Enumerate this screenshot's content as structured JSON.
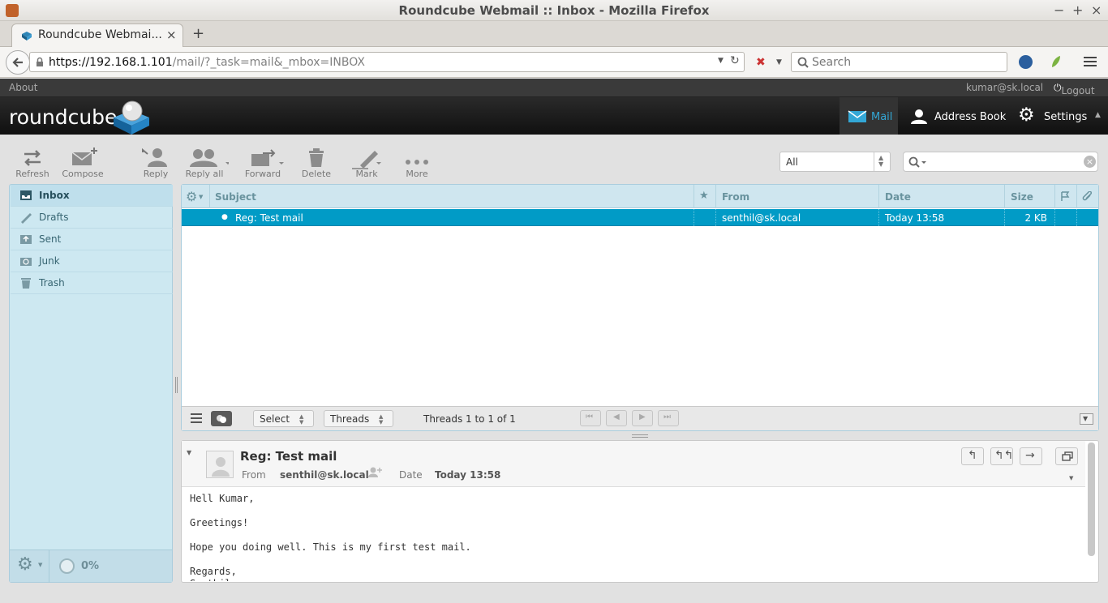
{
  "window": {
    "title": "Roundcube Webmail :: Inbox - Mozilla Firefox"
  },
  "browser": {
    "tab_title": "Roundcube Webmai...",
    "url_host": "https://192.168.1.101",
    "url_path": "/mail/?_task=mail&_mbox=INBOX",
    "search_placeholder": "Search"
  },
  "topbar": {
    "about": "About",
    "user": "kumar@sk.local",
    "logout": "Logout"
  },
  "app": {
    "logo": "roundcube",
    "nav": [
      {
        "label": "Mail",
        "icon": "envelope-icon",
        "active": true
      },
      {
        "label": "Address Book",
        "icon": "person-icon"
      },
      {
        "label": "Settings",
        "icon": "gear-icon"
      }
    ]
  },
  "toolbar": {
    "refresh": "Refresh",
    "compose": "Compose",
    "reply": "Reply",
    "reply_all": "Reply all",
    "forward": "Forward",
    "delete": "Delete",
    "mark": "Mark",
    "more": "More",
    "filter": "All"
  },
  "folders": [
    {
      "name": "Inbox",
      "icon": "inbox-icon",
      "active": true
    },
    {
      "name": "Drafts",
      "icon": "pencil-icon"
    },
    {
      "name": "Sent",
      "icon": "sent-icon"
    },
    {
      "name": "Junk",
      "icon": "junk-icon"
    },
    {
      "name": "Trash",
      "icon": "trash-icon"
    }
  ],
  "quota": "0%",
  "list": {
    "columns": {
      "subject": "Subject",
      "from": "From",
      "date": "Date",
      "size": "Size"
    },
    "rows": [
      {
        "subject": "Reg: Test mail",
        "from": "senthil@sk.local",
        "date": "Today 13:58",
        "size": "2 KB"
      }
    ],
    "select": "Select",
    "threads": "Threads",
    "count": "Threads 1 to 1 of 1"
  },
  "preview": {
    "subject": "Reg: Test mail",
    "from_label": "From",
    "from": "senthil@sk.local",
    "date_label": "Date",
    "date": "Today 13:58",
    "body": [
      "Hell Kumar,",
      "",
      "Greetings!",
      "",
      "Hope you doing well. This is my first test mail.",
      "",
      "Regards,",
      "Senthil"
    ]
  },
  "colors": {
    "accent": "#019bc6",
    "folder_bg": "#cde8f1",
    "header_bg": "#1c1c1c"
  }
}
